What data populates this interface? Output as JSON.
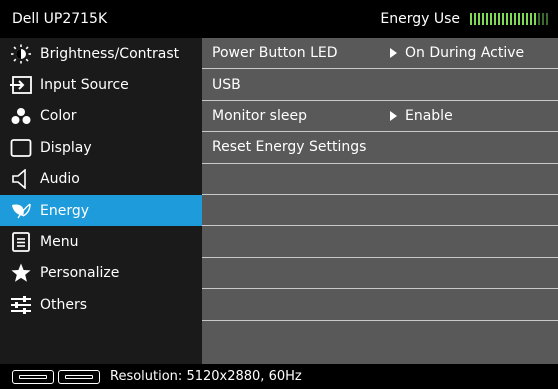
{
  "window": {
    "title": "Dell UP2715K"
  },
  "header": {
    "energy_label": "Energy Use",
    "energy_level": 0.85,
    "energy_color": "#7ed957"
  },
  "sidebar": {
    "active_color": "#1e9bdb",
    "items": [
      {
        "label": "Brightness/Contrast",
        "icon": "brightness-icon"
      },
      {
        "label": "Input Source",
        "icon": "input-source-icon"
      },
      {
        "label": "Color",
        "icon": "color-icon"
      },
      {
        "label": "Display",
        "icon": "display-icon"
      },
      {
        "label": "Audio",
        "icon": "speaker-icon"
      },
      {
        "label": "Energy",
        "icon": "leaf-icon",
        "active": true
      },
      {
        "label": "Menu",
        "icon": "menu-icon"
      },
      {
        "label": "Personalize",
        "icon": "star-icon"
      },
      {
        "label": "Others",
        "icon": "sliders-icon"
      }
    ]
  },
  "main": {
    "rows": [
      {
        "label": "Power Button LED",
        "value": "On During Active"
      },
      {
        "label": "USB",
        "value": ""
      },
      {
        "label": "Monitor sleep",
        "value": "Enable"
      },
      {
        "label": "Reset Energy Settings",
        "value": ""
      }
    ]
  },
  "status": {
    "resolution": "Resolution: 5120x2880, 60Hz"
  }
}
